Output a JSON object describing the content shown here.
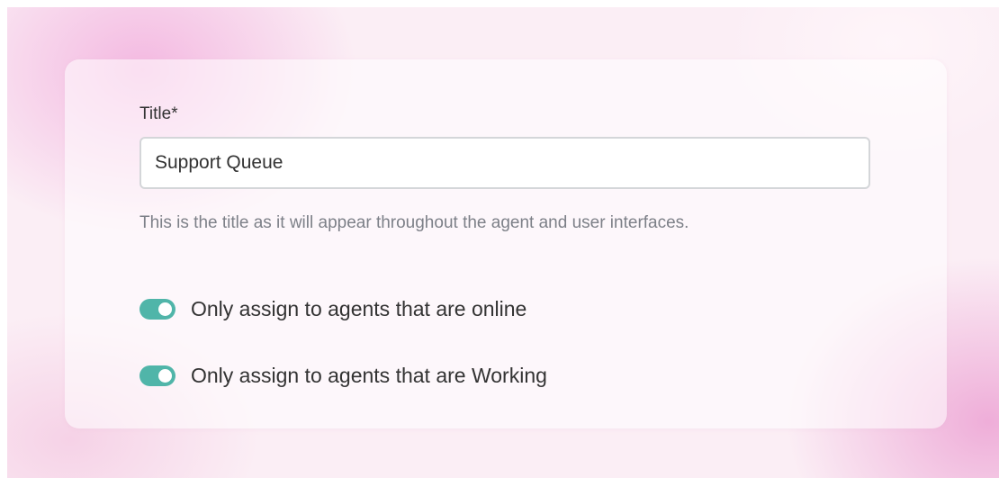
{
  "form": {
    "title_label": "Title*",
    "title_value": "Support Queue",
    "help_text": "This is the title as it will appear throughout the agent and user interfaces.",
    "toggles": [
      {
        "label": "Only assign to agents that are online",
        "checked": true
      },
      {
        "label": "Only assign to agents that are Working",
        "checked": true
      }
    ]
  },
  "colors": {
    "toggle_on": "#50b5a9",
    "text": "#333333",
    "help_text": "#7d8088",
    "input_border": "#d4d6d9",
    "background_pink": "#f3b6e0"
  }
}
